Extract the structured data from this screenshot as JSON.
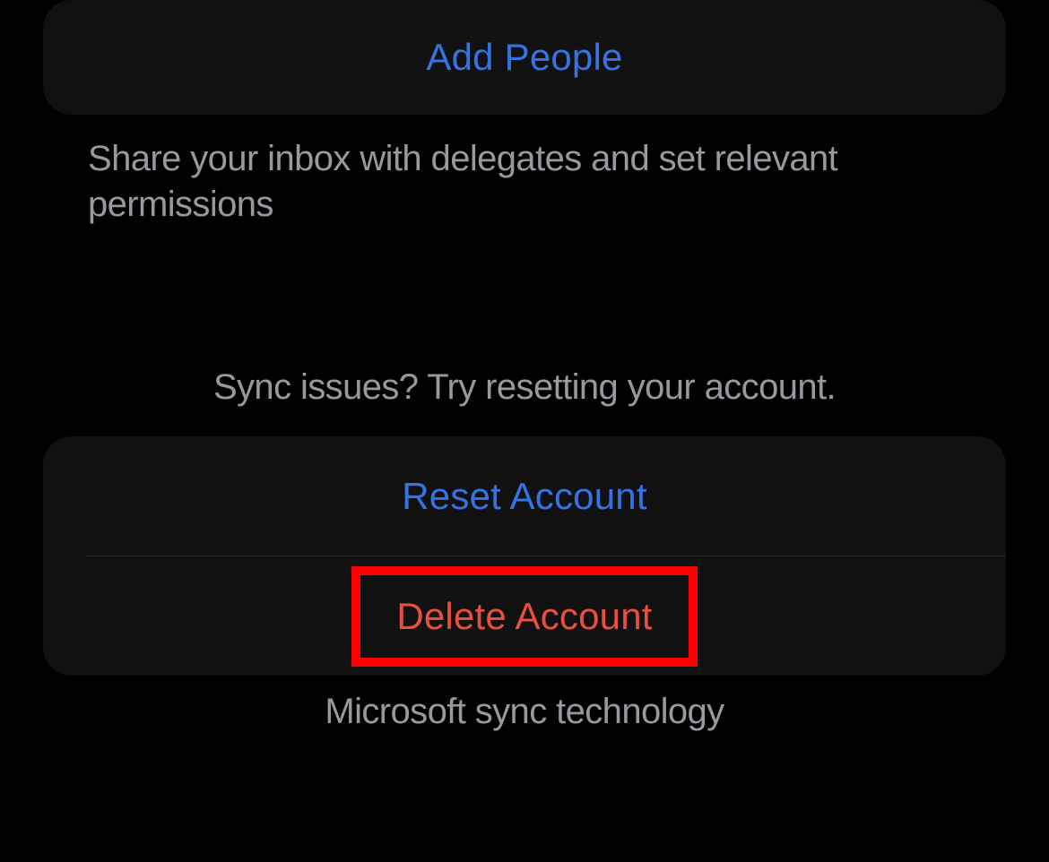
{
  "delegates": {
    "add_people_label": "Add People",
    "footer": "Share your inbox with delegates and set relevant permissions"
  },
  "account": {
    "header": "Sync issues? Try resetting your account.",
    "reset_label": "Reset Account",
    "delete_label": "Delete Account",
    "sync_label": "Microsoft sync technology"
  },
  "colors": {
    "accent_blue": "#3373e3",
    "destructive_red": "#eb4e3d",
    "highlight_frame": "#ff0000",
    "background": "#000000",
    "card_bg": "#111112",
    "secondary_text": "#98989f"
  }
}
